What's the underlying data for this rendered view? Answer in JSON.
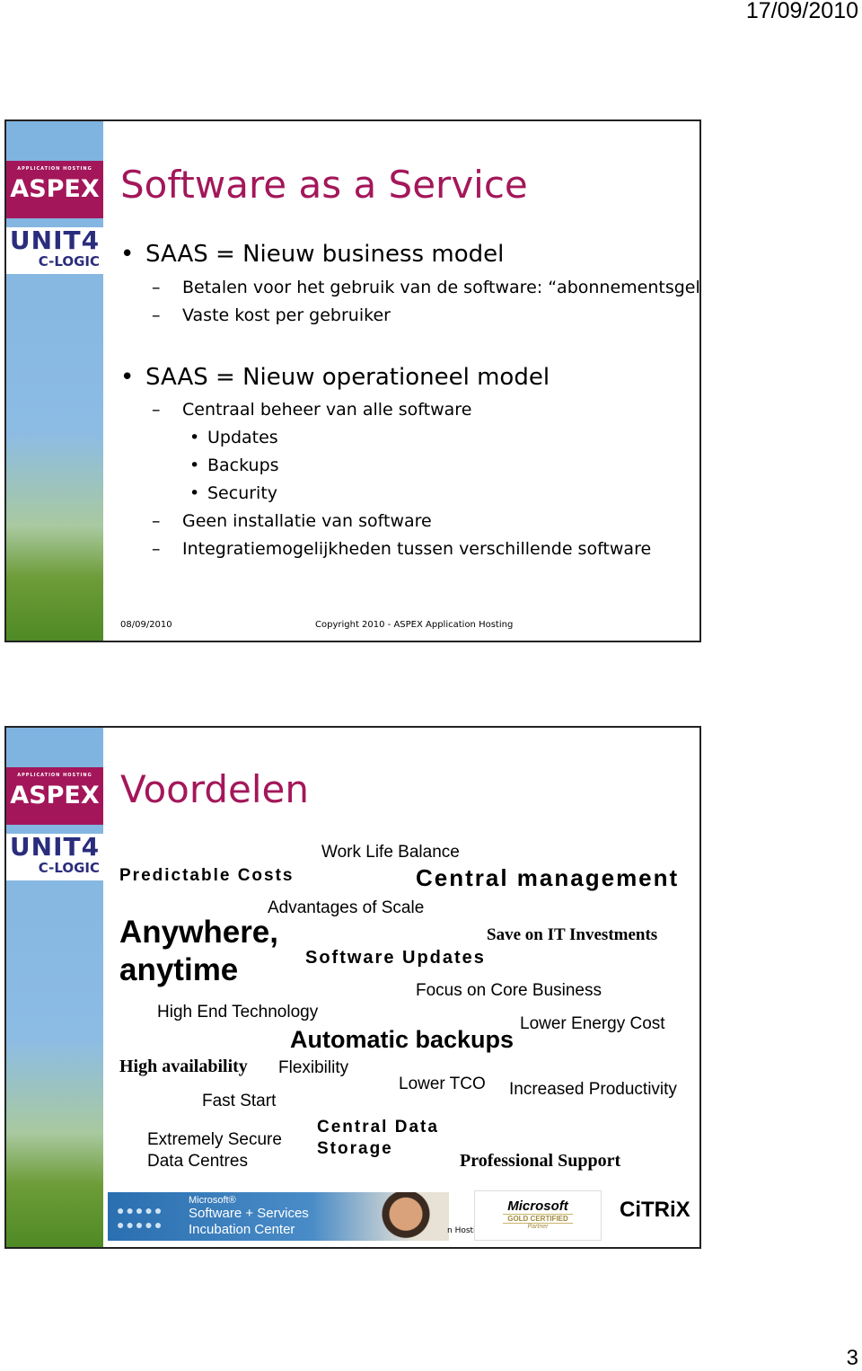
{
  "header": {
    "date": "17/09/2010"
  },
  "page_number": "3",
  "logos": {
    "aspex_tag": "APPLICATION HOSTING",
    "aspex": "ASPEX",
    "unit4": "UNIT4",
    "clogic": "C-LOGIC"
  },
  "slide1": {
    "title": "Software as a Service",
    "items": [
      {
        "level": 1,
        "text": "SAAS = Nieuw business model"
      },
      {
        "level": 2,
        "text": "Betalen voor het gebruik van de software: “abonnementsgeld”"
      },
      {
        "level": 2,
        "text": "Vaste kost per gebruiker"
      },
      {
        "level": 1,
        "text": "SAAS = Nieuw operationeel model"
      },
      {
        "level": 2,
        "text": "Centraal beheer van alle software"
      },
      {
        "level": 3,
        "text": "Updates"
      },
      {
        "level": 3,
        "text": "Backups"
      },
      {
        "level": 3,
        "text": "Security"
      },
      {
        "level": 2,
        "text": "Geen installatie van software"
      },
      {
        "level": 2,
        "text": "Integratiemogelijkheden tussen verschillende software"
      }
    ],
    "footer_date": "08/09/2010",
    "footer_copyright": "Copyright 2010 - ASPEX Application Hosting"
  },
  "slide2": {
    "title": "Voordelen",
    "words": [
      "Work Life Balance",
      "Predictable Costs",
      "Central management",
      "Advantages of Scale",
      "Anywhere,",
      "anytime",
      "Save on IT Investments",
      "Software Updates",
      "Focus on Core Business",
      "High End Technology",
      "Lower Energy Cost",
      "Automatic backups",
      "High availability",
      "Flexibility",
      "Lower TCO",
      "Increased Productivity",
      "Fast Start",
      "Extremely Secure",
      "Data Centres",
      "Central Data",
      "Storage",
      "Professional Support"
    ],
    "partner_logos": {
      "ms_small": "Microsoft®",
      "ms_line1": "Software + Services",
      "ms_line2": "Incubation Center",
      "hidden_footer": "n Hosti",
      "gold_ms": "Microsoft",
      "gold_cert": "GOLD CERTIFIED",
      "gold_partner": "Partner",
      "citrix": "CiTRiX"
    }
  }
}
